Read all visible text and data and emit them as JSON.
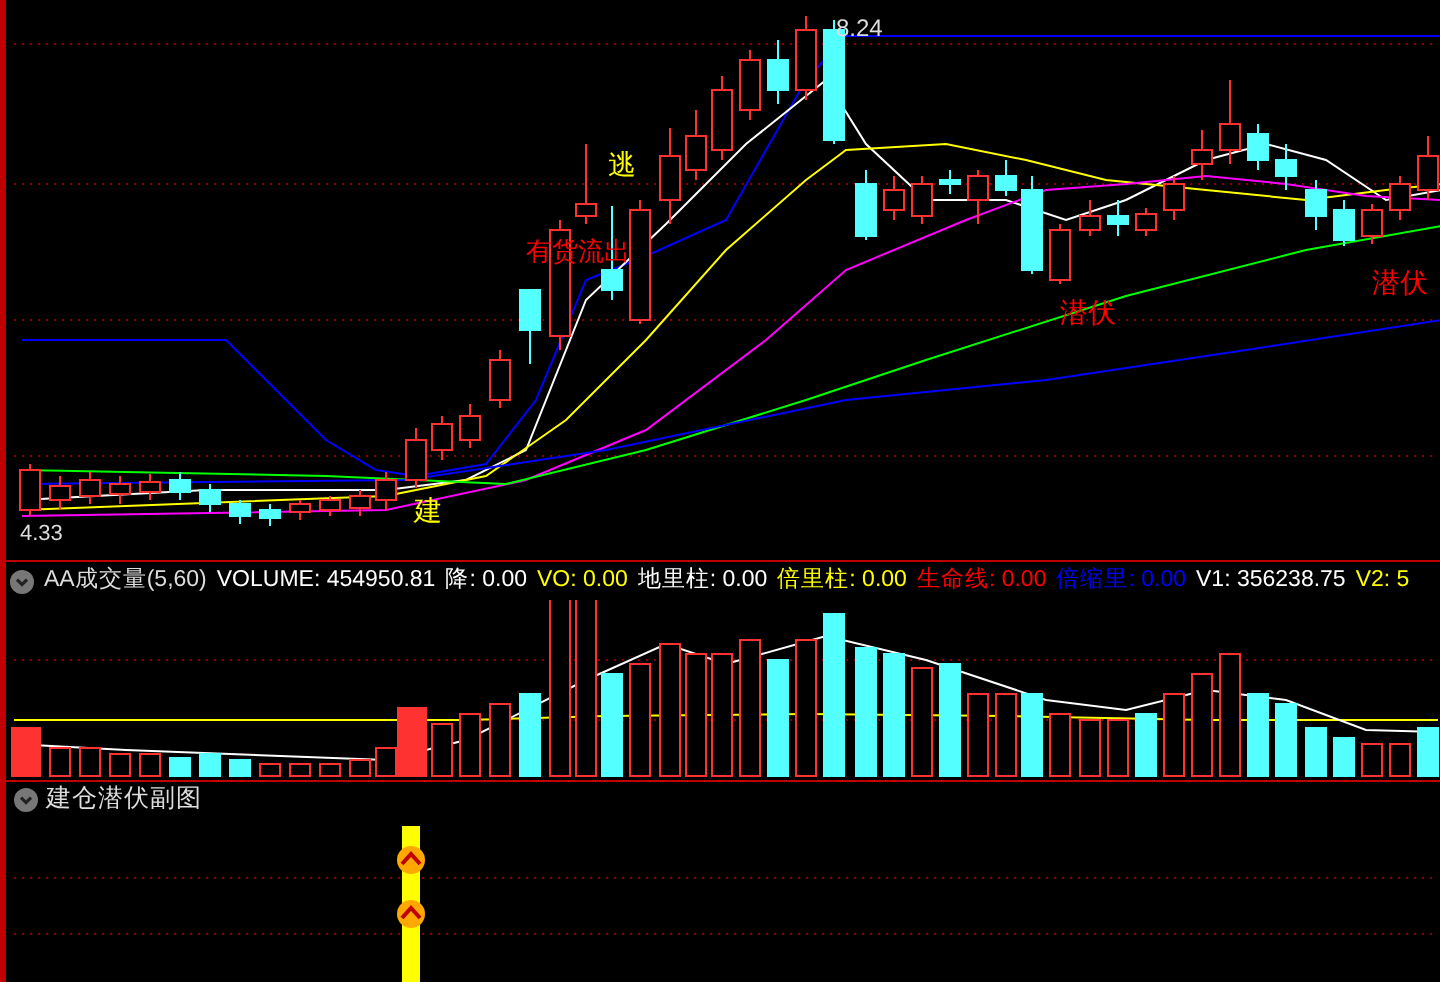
{
  "main_chart": {
    "high_label": "8.24",
    "low_label": "4.33",
    "signals": [
      {
        "text": "逃",
        "color": "#ffff00"
      },
      {
        "text": "有货流出",
        "color": "#ff0000"
      },
      {
        "text": "建",
        "color": "#ffff00"
      },
      {
        "text": "潜伏",
        "color": "#ff0000"
      },
      {
        "text": "潜伏",
        "color": "#ff0000"
      }
    ]
  },
  "volume_panel": {
    "title": "AA成交量(5,60)",
    "items": [
      {
        "text": "VOLUME: 454950.81",
        "color": "#ffffff"
      },
      {
        "text": "降: 0.00",
        "color": "#ffffff"
      },
      {
        "text": "VO: 0.00",
        "color": "#ffff00"
      },
      {
        "text": "地里柱: 0.00",
        "color": "#ffffff"
      },
      {
        "text": "倍里柱: 0.00",
        "color": "#ffff00"
      },
      {
        "text": "生命线: 0.00",
        "color": "#ff0000"
      },
      {
        "text": "倍缩里: 0.00",
        "color": "#0000ff"
      },
      {
        "text": "V1: 356238.75",
        "color": "#ffffff"
      },
      {
        "text": "V2: 5",
        "color": "#ffff00"
      }
    ]
  },
  "sub_panel": {
    "title": "建仓潜伏副图"
  }
}
